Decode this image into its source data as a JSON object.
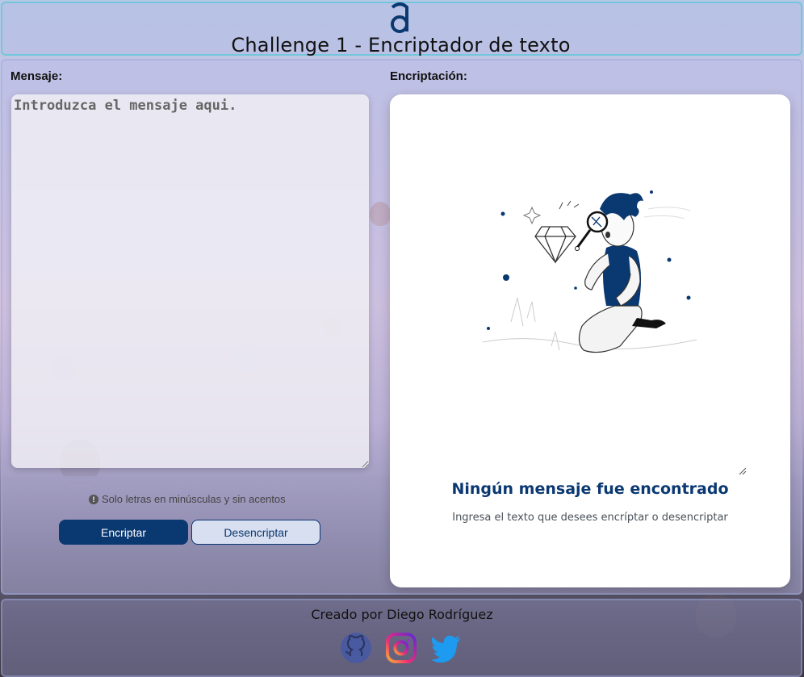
{
  "header": {
    "logo_icon": "alura-a-logo-icon",
    "title": "Challenge 1 - Encriptador de texto"
  },
  "input_panel": {
    "label": "Mensaje:",
    "placeholder": "Introduzca el mensaje aqui.",
    "hint": "Solo letras en minúsculas y sin acentos",
    "encrypt_label": "Encriptar",
    "decrypt_label": "Desencriptar"
  },
  "output_panel": {
    "label": "Encriptación:",
    "empty_title": "Ningún mensaje fue encontrado",
    "empty_subtitle": "Ingresa el texto que desees encríptar o desencriptar"
  },
  "footer": {
    "credit": "Creado por Diego Rodríguez",
    "social": [
      "github-icon",
      "instagram-icon",
      "twitter-icon"
    ]
  },
  "colors": {
    "primary": "#0a3871",
    "secondary_button": "#d8dff0",
    "card": "#ffffff"
  }
}
